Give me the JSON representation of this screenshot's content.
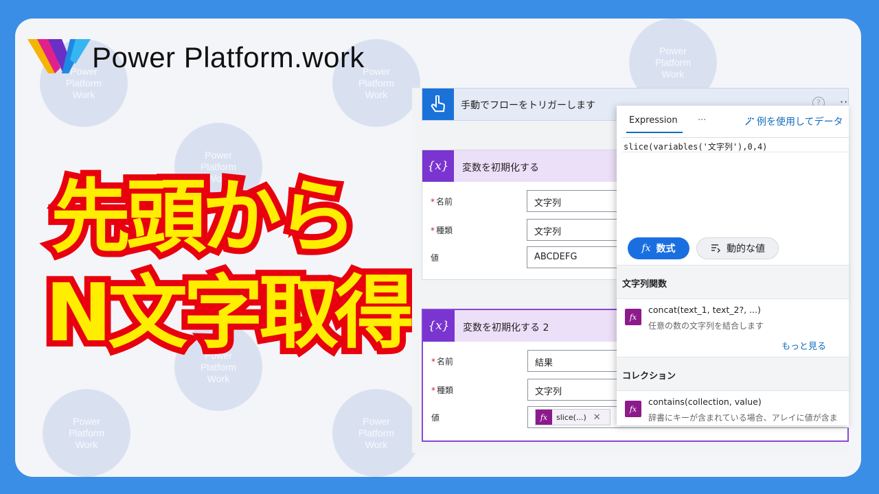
{
  "brand": {
    "name": "Power Platform.work",
    "watermark_lines": [
      "Power",
      "Platform",
      "Work"
    ]
  },
  "headline": {
    "line1": "先頭から",
    "line2": "N文字取得"
  },
  "flow": {
    "trigger_title": "手動でフローをトリガーします",
    "trigger_help": "?",
    "trigger_more": "···",
    "action1": {
      "title": "変数を初期化する",
      "rows": [
        {
          "label": "名前",
          "required": true,
          "value": "文字列"
        },
        {
          "label": "種類",
          "required": true,
          "value": "文字列"
        },
        {
          "label": "値",
          "required": false,
          "value": "ABCDEFG"
        }
      ]
    },
    "action2": {
      "title": "変数を初期化する 2",
      "rows": [
        {
          "label": "名前",
          "required": true,
          "value": "結果"
        },
        {
          "label": "種類",
          "required": true,
          "value": "文字列"
        },
        {
          "label": "値",
          "required": false,
          "value": ""
        }
      ],
      "token": {
        "icon": "fx",
        "text": "slice(...)",
        "remove": "✕"
      }
    },
    "var_icon": "{x}",
    "required_mark": "*"
  },
  "panel": {
    "tab_expression": "Expression",
    "tab_more": "···",
    "example_label": "例を使用してデータ",
    "expression": "slice(variables('文字列'),0,4)",
    "btn_formula": "数式",
    "btn_formula_icon": "fx",
    "btn_dynamic": "動的な値",
    "section_string": "文字列関数",
    "func1_name": "concat(text_1, text_2?, ...)",
    "func1_desc": "任意の数の文字列を結合します",
    "more_link": "もっと見る",
    "section_collection": "コレクション",
    "func2_name": "contains(collection, value)",
    "func2_desc": "辞書にキーが含まれている場合、アレイに値が含ま",
    "fx_icon": "fx"
  },
  "colors": {
    "frame": "#3a8ee6",
    "headline_fill": "#ffee00",
    "headline_stroke": "#e8000e",
    "accent_blue": "#1a6fe0",
    "variable_purple": "#7a34cf",
    "function_magenta": "#8c1a8c"
  }
}
